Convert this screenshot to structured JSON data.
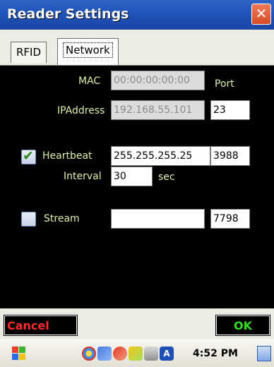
{
  "window": {
    "title": "Reader Settings"
  },
  "tabs": [
    {
      "label": "RFID"
    },
    {
      "label": "Network"
    }
  ],
  "network": {
    "mac": {
      "label": "MAC",
      "value": "00:00:00:00:00"
    },
    "port_label": "Port",
    "ip": {
      "label": "IPAddress",
      "value": "192.168.55.101",
      "port": "23"
    },
    "heartbeat": {
      "label": "Heartbeat",
      "checked": true,
      "address": "255.255.255.25",
      "port": "3988"
    },
    "interval": {
      "label": "Interval",
      "value": "30",
      "unit": "sec"
    },
    "stream": {
      "label": "Stream",
      "checked": false,
      "address": "",
      "port": "7798"
    }
  },
  "buttons": {
    "cancel": "Cancel",
    "ok": "OK"
  },
  "taskbar": {
    "time": "4:52 PM"
  },
  "colors": {
    "cancel": "#ff2a2a",
    "ok": "#33dd22",
    "label": "#d9f2a6",
    "title_bar": "#1d4fb4"
  }
}
